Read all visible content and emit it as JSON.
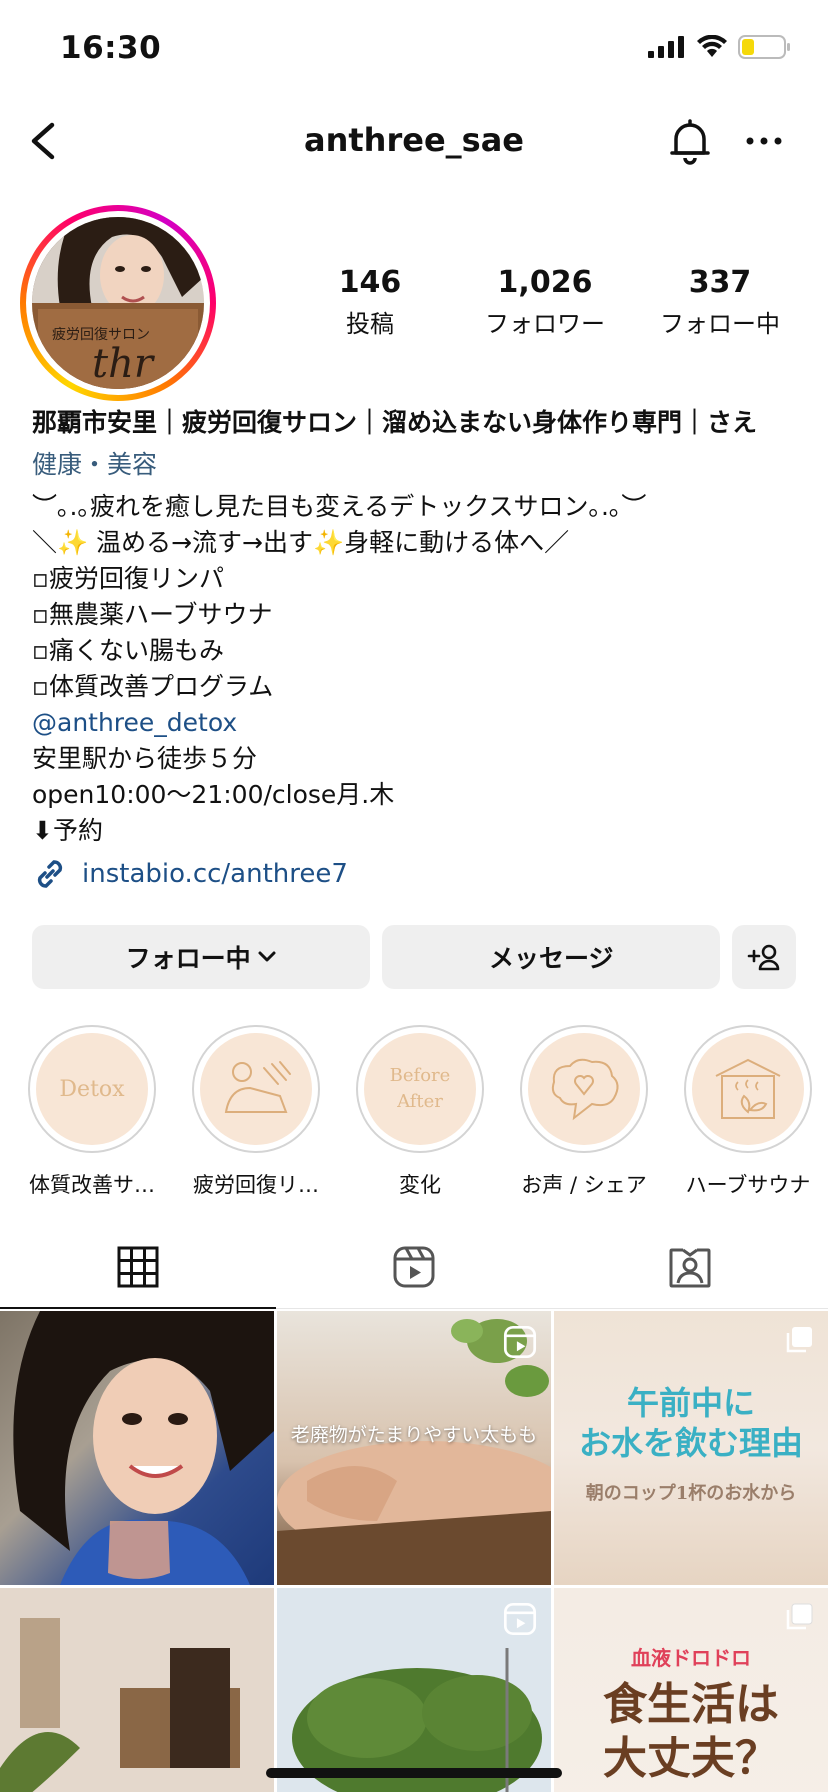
{
  "status_bar": {
    "time": "16:30"
  },
  "nav": {
    "username": "anthree_sae"
  },
  "profile": {
    "stats": [
      {
        "value": "146",
        "label": "投稿"
      },
      {
        "value": "1,026",
        "label": "フォロワー"
      },
      {
        "value": "337",
        "label": "フォロー中"
      }
    ],
    "name": "那覇市安里｜疲労回復サロン｜溜め込まない身体作り専門｜さえ",
    "category": "健康・美容",
    "bio_lines": [
      "︶｡.｡疲れを癒し見た目も変えるデトックスサロン｡.｡︶",
      "＼✨ 温める→流す→出す✨身軽に動ける体へ／",
      "▫︎疲労回復リンパ",
      "▫︎無農薬ハーブサウナ",
      "▫︎痛くない腸もみ",
      "▫︎体質改善プログラム",
      "@anthree_detox",
      "安里駅から徒歩５分",
      "open10:00～21:00/close月.木",
      "⬇︎予約"
    ],
    "link": "instabio.cc/anthree7"
  },
  "actions": {
    "follow_label": "フォロー中",
    "message_label": "メッセージ"
  },
  "highlights": [
    {
      "label": "体質改善サ…",
      "cover_text": "Detox"
    },
    {
      "label": "疲労回復リ…",
      "cover_text": ""
    },
    {
      "label": "変化",
      "cover_text": "Before After"
    },
    {
      "label": "お声 / シェア",
      "cover_text": ""
    },
    {
      "label": "ハーブサウナ",
      "cover_text": ""
    }
  ],
  "grid": {
    "post2_caption": "老廃物がたまりやすい太もも",
    "post3_title_line1": "午前中に",
    "post3_title_line2": "お水を飲む理由",
    "post3_subtitle": "朝のコップ1杯のお水から",
    "post6_subtitle": "血液ドロドロ",
    "post6_title_line1": "食生活は",
    "post6_title_line2": "大丈夫？"
  },
  "colors": {
    "link": "#1d4f86",
    "category": "#385c7c",
    "button_bg": "#efefef",
    "highlight_bg": "#f8e6d6"
  }
}
